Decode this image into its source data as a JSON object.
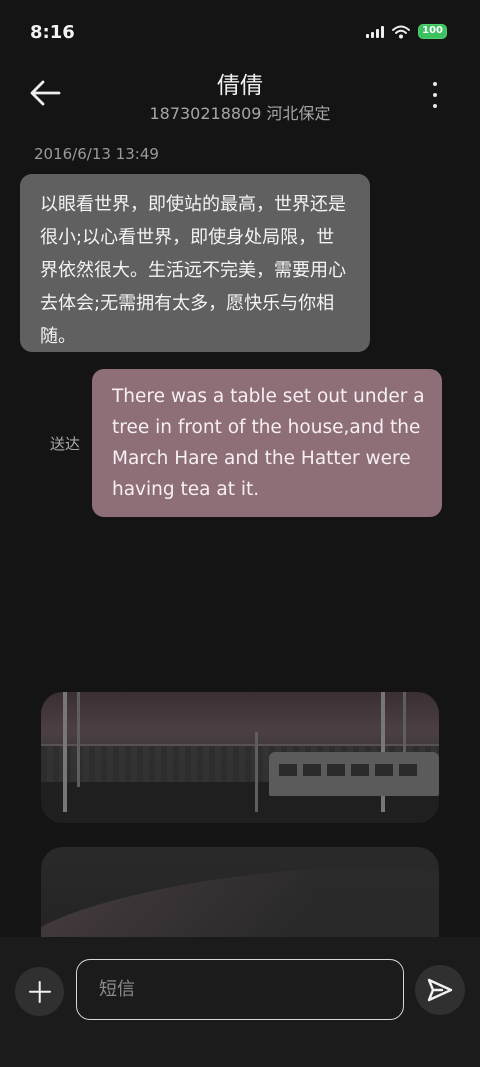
{
  "status_bar": {
    "time": "8:16",
    "battery": "100",
    "icons": [
      "signal-icon",
      "wifi-icon",
      "battery-icon"
    ],
    "battery_color": "#3cc162"
  },
  "header": {
    "contact_name": "倩倩",
    "contact_subtitle": "18730218809 河北保定",
    "icons": [
      "back-arrow-icon",
      "more-vertical-icon"
    ]
  },
  "conversation": {
    "timestamp": "2016/6/13 13:49",
    "incoming_message": "以眼看世界，即使站的最高，世界还是很小;以心看世界，即使身处局限，世界依然很大。生活远不完美，需要用心去体会;无需拥有太多，愿快乐与你相随。",
    "sent_status": "送达",
    "outgoing_message": "There was a table set out under a tree in front of the house,and the March Hare and the Hatter were having tea at it.",
    "incoming_color": "#606060",
    "outgoing_color": "#8e6f77"
  },
  "composer": {
    "placeholder": "短信",
    "icons": [
      "add-icon",
      "send-icon"
    ]
  }
}
